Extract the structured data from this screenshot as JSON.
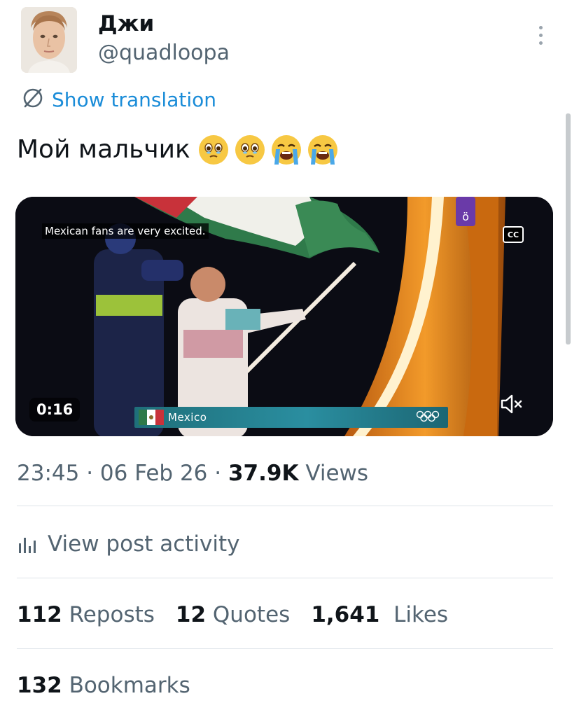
{
  "author": {
    "display_name": "Джи",
    "handle": "@quadloopa"
  },
  "translate": {
    "label": "Show translation",
    "icon": "globe-slash-icon"
  },
  "tweet": {
    "text": "Мой мальчик",
    "emojis": [
      "face-holding-back-tears-emoji",
      "face-holding-back-tears-emoji",
      "loudly-crying-face-emoji",
      "loudly-crying-face-emoji"
    ]
  },
  "video": {
    "caption": "Mexican fans are very excited.",
    "cc_label": "CC",
    "duration": "0:16",
    "lower_third_country": "Mexico",
    "muted": true
  },
  "meta": {
    "time": "23:45",
    "date": "06 Feb 26",
    "views_count": "37.9K",
    "views_label": "Views"
  },
  "activity": {
    "label": "View post activity",
    "icon": "analytics-bars-icon"
  },
  "stats": {
    "reposts": {
      "count": "112",
      "label": "Reposts"
    },
    "quotes": {
      "count": "12",
      "label": "Quotes"
    },
    "likes": {
      "count": "1,641",
      "label": "Likes"
    },
    "bookmarks": {
      "count": "132",
      "label": "Bookmarks"
    }
  },
  "colors": {
    "link": "#1a8cd8",
    "secondary_text": "#536471",
    "primary_text": "#0f1419",
    "divider": "#dde3e8",
    "flag_green": "#2f7a4a",
    "flag_red": "#c8323a",
    "olympic_orange": "#e07a1a"
  }
}
